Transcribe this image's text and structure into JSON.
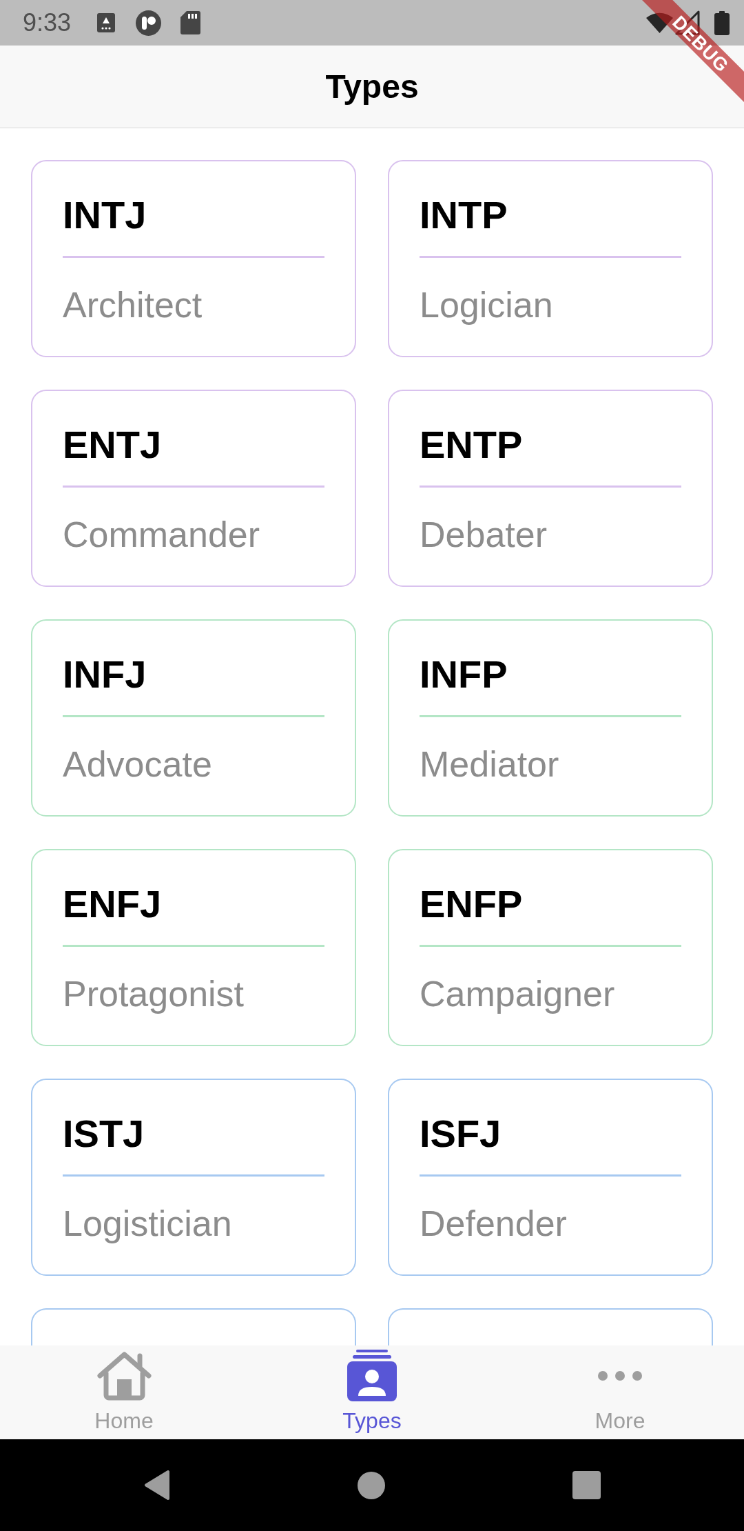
{
  "status_bar": {
    "time": "9:33"
  },
  "debug_banner": "DEBUG",
  "app_bar": {
    "title": "Types"
  },
  "cards": [
    {
      "title": "INTJ",
      "subtitle": "Architect",
      "color": "#d9c2ee"
    },
    {
      "title": "INTP",
      "subtitle": "Logician",
      "color": "#d9c2ee"
    },
    {
      "title": "ENTJ",
      "subtitle": "Commander",
      "color": "#d9c2ee"
    },
    {
      "title": "ENTP",
      "subtitle": "Debater",
      "color": "#d9c2ee"
    },
    {
      "title": "INFJ",
      "subtitle": "Advocate",
      "color": "#b4e6c6"
    },
    {
      "title": "INFP",
      "subtitle": "Mediator",
      "color": "#b4e6c6"
    },
    {
      "title": "ENFJ",
      "subtitle": "Protagonist",
      "color": "#b4e6c6"
    },
    {
      "title": "ENFP",
      "subtitle": "Campaigner",
      "color": "#b4e6c6"
    },
    {
      "title": "ISTJ",
      "subtitle": "Logistician",
      "color": "#a7c9f1"
    },
    {
      "title": "ISFJ",
      "subtitle": "Defender",
      "color": "#a7c9f1"
    },
    {
      "color": "#a7c9f1"
    },
    {
      "color": "#a7c9f1"
    }
  ],
  "bottom_nav": [
    {
      "label": "Home",
      "selected": false
    },
    {
      "label": "Types",
      "selected": true
    },
    {
      "label": "More",
      "selected": false
    }
  ]
}
